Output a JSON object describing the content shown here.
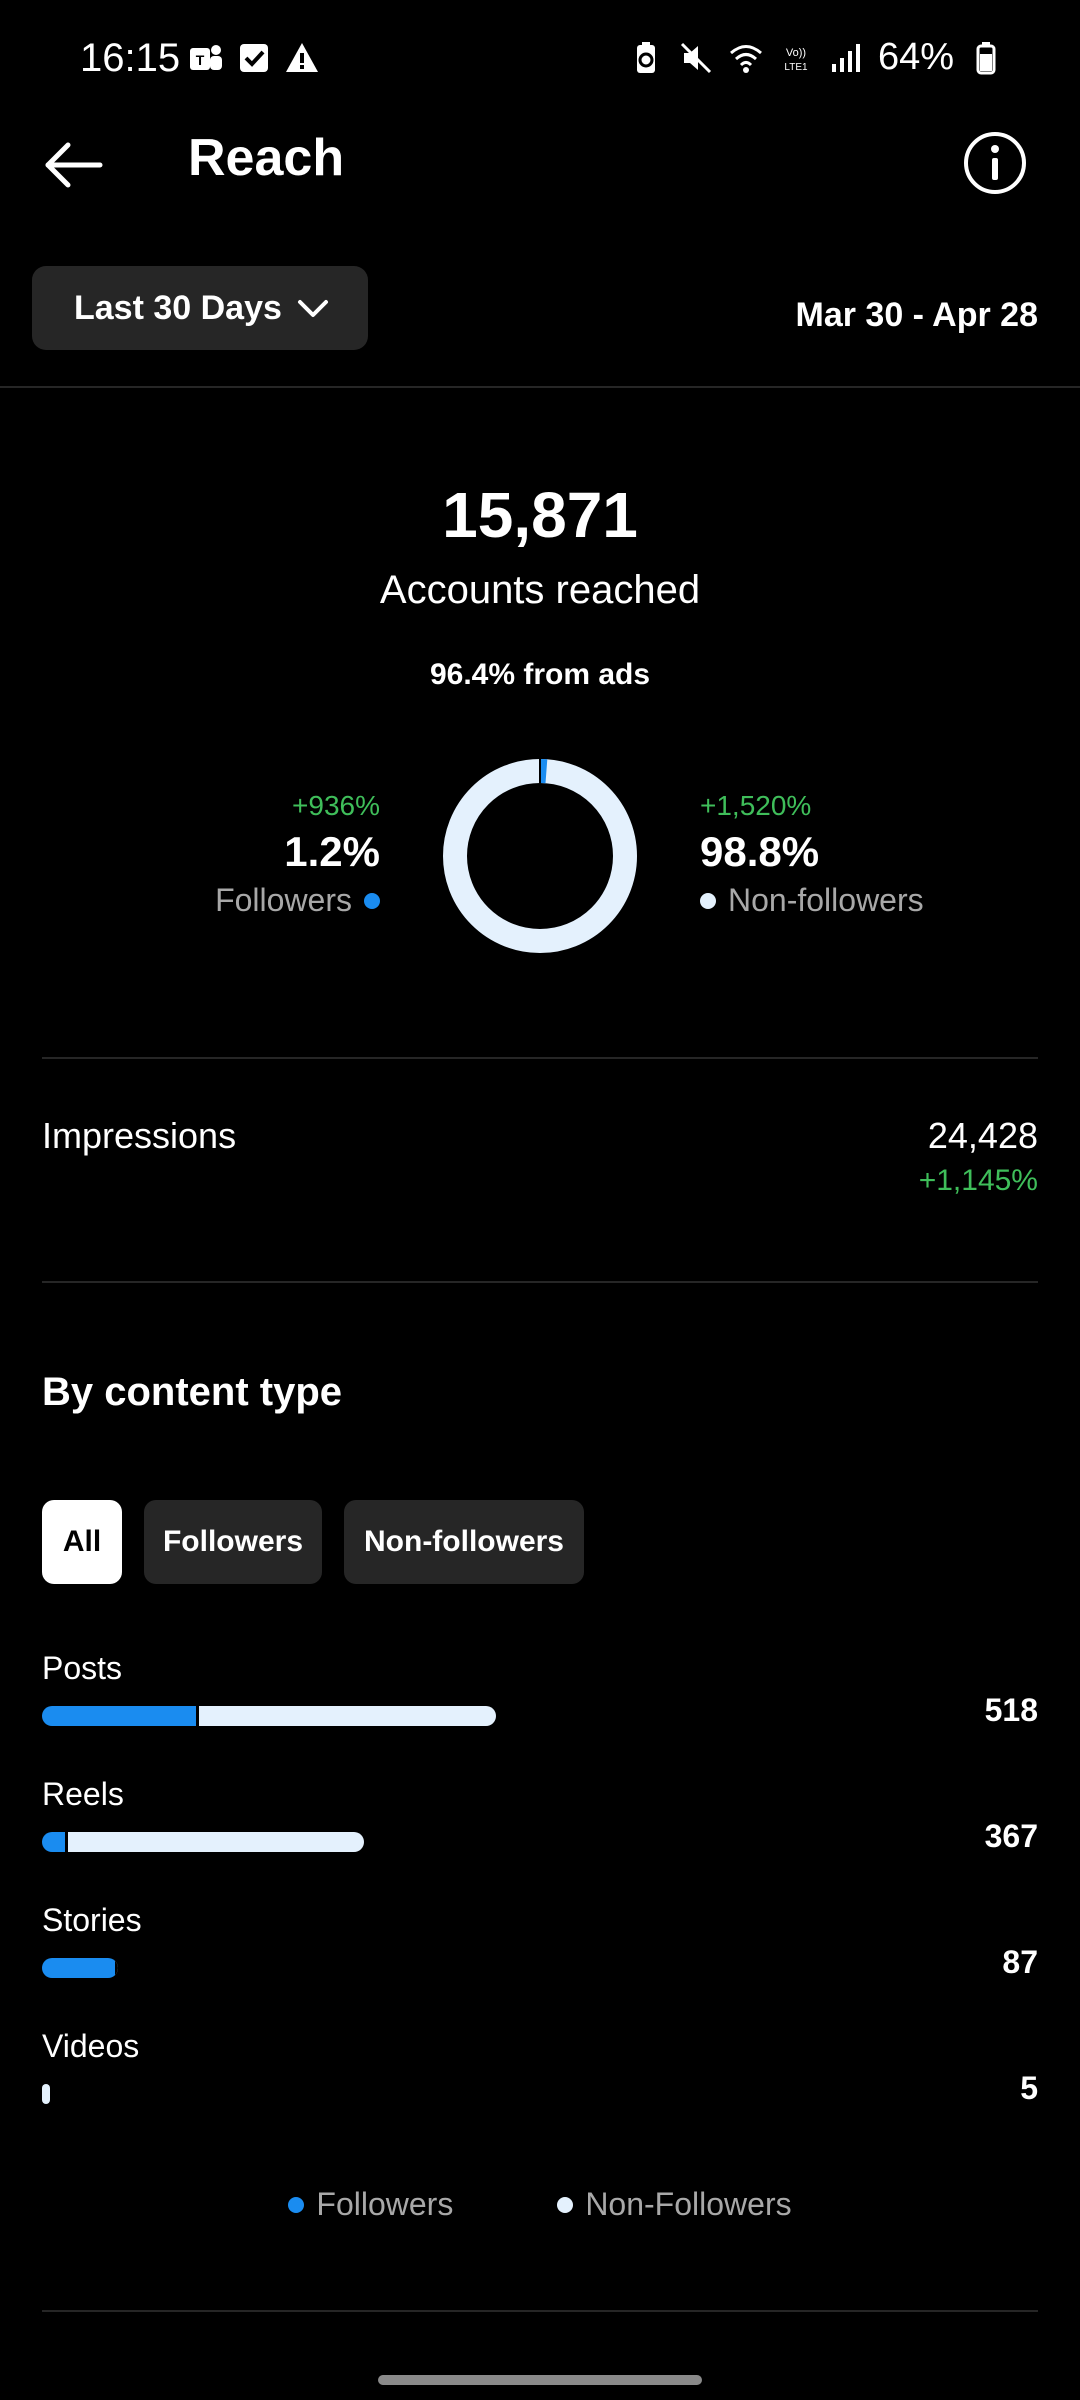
{
  "status_bar": {
    "time": "16:15",
    "battery": "64%"
  },
  "header": {
    "title": "Reach"
  },
  "range": {
    "dropdown_label": "Last 30 Days",
    "dates": "Mar 30 - Apr 28"
  },
  "summary": {
    "accounts_reached": "15,871",
    "caption": "Accounts reached",
    "ads_note": "96.4% from ads",
    "followers": {
      "change": "+936%",
      "percent": "1.2%",
      "label": "Followers",
      "fraction": 0.012
    },
    "non_followers": {
      "change": "+1,520%",
      "percent": "98.8%",
      "label": "Non-followers",
      "fraction": 0.988
    }
  },
  "impressions": {
    "label": "Impressions",
    "value": "24,428",
    "change": "+1,145%"
  },
  "content_type": {
    "title": "By content type",
    "filters": [
      "All",
      "Followers",
      "Non-followers"
    ],
    "active_filter": "All",
    "rows": [
      {
        "label": "Posts",
        "value": "518",
        "total": 518,
        "followers_fraction": 0.34
      },
      {
        "label": "Reels",
        "value": "367",
        "total": 367,
        "followers_fraction": 0.07
      },
      {
        "label": "Stories",
        "value": "87",
        "total": 87,
        "followers_fraction": 0.97
      },
      {
        "label": "Videos",
        "value": "5",
        "total": 5,
        "followers_fraction": 0.0
      }
    ],
    "legend": {
      "followers": "Followers",
      "non_followers": "Non-Followers"
    }
  },
  "colors": {
    "followers": "#1a8cf0",
    "non_followers": "#e4f1fd",
    "positive_change": "#3fbe5a"
  }
}
